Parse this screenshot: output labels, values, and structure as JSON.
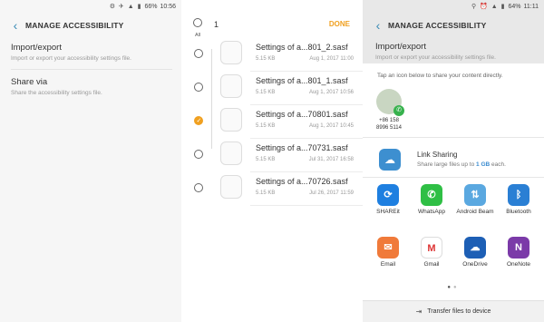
{
  "panel1": {
    "status": {
      "battery": "66%",
      "time": "10:56"
    },
    "title": "MANAGE ACCESSIBILITY",
    "rows": [
      {
        "title": "Import/export",
        "subtitle": "Import or export your accessibility settings file."
      },
      {
        "title": "Share via",
        "subtitle": "Share the accessibility settings file."
      }
    ]
  },
  "panel2": {
    "select_all_label": "All",
    "count": "1",
    "done": "DONE",
    "files": [
      {
        "name": "Settings of a...801_2.sasf",
        "size": "5.15 KB",
        "date": "Aug 1, 2017 11:00",
        "checked": false
      },
      {
        "name": "Settings of a...801_1.sasf",
        "size": "5.15 KB",
        "date": "Aug 1, 2017 10:56",
        "checked": false
      },
      {
        "name": "Settings of a...70801.sasf",
        "size": "5.15 KB",
        "date": "Aug 1, 2017 10:45",
        "checked": true
      },
      {
        "name": "Settings of a...70731.sasf",
        "size": "5.15 KB",
        "date": "Jul 31, 2017 16:58",
        "checked": false
      },
      {
        "name": "Settings of a...70726.sasf",
        "size": "5.15 KB",
        "date": "Jul 26, 2017 11:59",
        "checked": false
      }
    ]
  },
  "panel3": {
    "status": {
      "battery": "64%",
      "time": "11:11"
    },
    "title": "MANAGE ACCESSIBILITY",
    "row_title": "Import/export",
    "row_subtitle": "Import or export your accessibility settings file.",
    "hint": "Tap an icon below to share your content directly.",
    "contact": "+86 158 8996 5114",
    "link_sharing": {
      "title": "Link Sharing",
      "sub_prefix": "Share large files up to ",
      "sub_size": "1 GB",
      "sub_suffix": " each."
    },
    "apps": [
      {
        "label": "SHAREit",
        "icon": "shareit-icon",
        "color": "#1e7fe0",
        "glyph": "⟳"
      },
      {
        "label": "WhatsApp",
        "icon": "whatsapp-icon",
        "color": "#2fbf45",
        "glyph": "✆"
      },
      {
        "label": "Android Beam",
        "icon": "android-beam-icon",
        "color": "#5aa8e0",
        "glyph": "⇅"
      },
      {
        "label": "Bluetooth",
        "icon": "bluetooth-icon",
        "color": "#2a7fd4",
        "glyph": "ᛒ"
      },
      {
        "label": "Email",
        "icon": "email-icon",
        "color": "#f07a3a",
        "glyph": "✉"
      },
      {
        "label": "Gmail",
        "icon": "gmail-icon",
        "color": "#ffffff",
        "glyph": "M"
      },
      {
        "label": "OneDrive",
        "icon": "onedrive-icon",
        "color": "#1d5fb5",
        "glyph": "☁"
      },
      {
        "label": "OneNote",
        "icon": "onenote-icon",
        "color": "#7b3aa8",
        "glyph": "N"
      }
    ],
    "footer": "Transfer files to device"
  }
}
